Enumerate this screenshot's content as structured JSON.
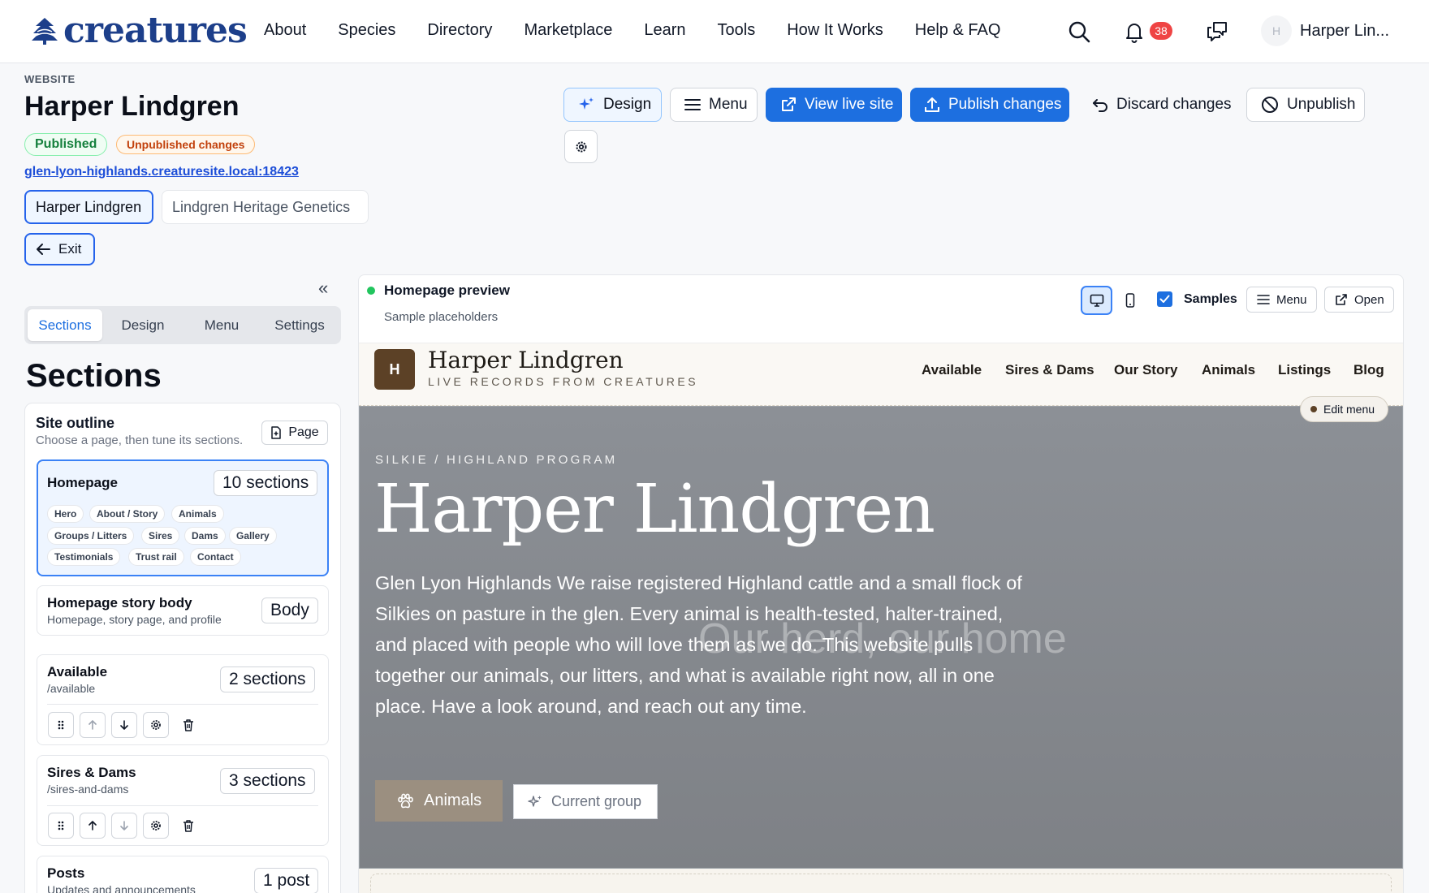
{
  "brand": {
    "name": "creatures",
    "color": "#1d3f8a"
  },
  "nav": {
    "links": [
      "About",
      "Species",
      "Directory",
      "Marketplace",
      "Learn",
      "Tools",
      "How It Works",
      "Help & FAQ"
    ],
    "notifications_count": "38",
    "user_initial": "H",
    "user_name": "Harper Lin..."
  },
  "header": {
    "kicker": "WEBSITE",
    "title": "Harper Lindgren",
    "status_published": "Published",
    "status_unpublished": "Unpublished changes",
    "site_url": "glen-lyon-highlands.creaturesite.local:18423",
    "site_tabs": [
      "Harper Lindgren",
      "Lindgren Heritage Genetics"
    ],
    "exit_label": "Exit"
  },
  "toolbar": {
    "design": "Design",
    "menu": "Menu",
    "view_live": "View live site",
    "publish": "Publish changes",
    "discard": "Discard changes",
    "unpublish": "Unpublish",
    "primary_color": "#1d6fe0"
  },
  "panel": {
    "tabs": [
      "Sections",
      "Design",
      "Menu",
      "Settings"
    ],
    "title": "Sections",
    "outline": {
      "title": "Site outline",
      "subtitle": "Choose a page, then tune its sections.",
      "page_button": "Page"
    },
    "pages": [
      {
        "name": "Homepage",
        "count": "10 sections",
        "chips": [
          "Hero",
          "About / Story",
          "Animals",
          "Groups / Litters",
          "Sires",
          "Dams",
          "Gallery",
          "Testimonials",
          "Trust rail",
          "Contact"
        ]
      },
      {
        "name": "Homepage story body",
        "path": "Homepage, story page, and profile",
        "count": "Body"
      },
      {
        "name": "Available",
        "path": "/available",
        "count": "2 sections"
      },
      {
        "name": "Sires & Dams",
        "path": "/sires-and-dams",
        "count": "3 sections"
      },
      {
        "name": "Posts",
        "path": "Updates and announcements",
        "count": "1 post"
      }
    ]
  },
  "preview": {
    "title": "Homepage preview",
    "subtitle": "Sample placeholders",
    "samples_label": "Samples",
    "menu_label": "Menu",
    "open_label": "Open",
    "site": {
      "logo_initial": "H",
      "name": "Harper Lindgren",
      "tagline": "LIVE RECORDS FROM CREATURES",
      "nav": [
        "Available",
        "Sires & Dams",
        "Our Story",
        "Animals",
        "Listings",
        "Blog"
      ],
      "edit_menu": "Edit menu",
      "hero_kicker": "SILKIE / HIGHLAND PROGRAM",
      "hero_title": "Harper Lindgren",
      "hero_ghost": "Our herd, our home",
      "hero_body": "Glen Lyon Highlands We raise registered Highland cattle and a small flock of Silkies on pasture in the glen. Every animal is health-tested, halter-trained, and placed with people who will love them as we do. This website pulls together our animals, our litters, and what is available right now, all in one place. Have a look around, and reach out any time.",
      "hero_btn_primary": "Animals",
      "hero_btn_secondary": "Current group"
    }
  }
}
